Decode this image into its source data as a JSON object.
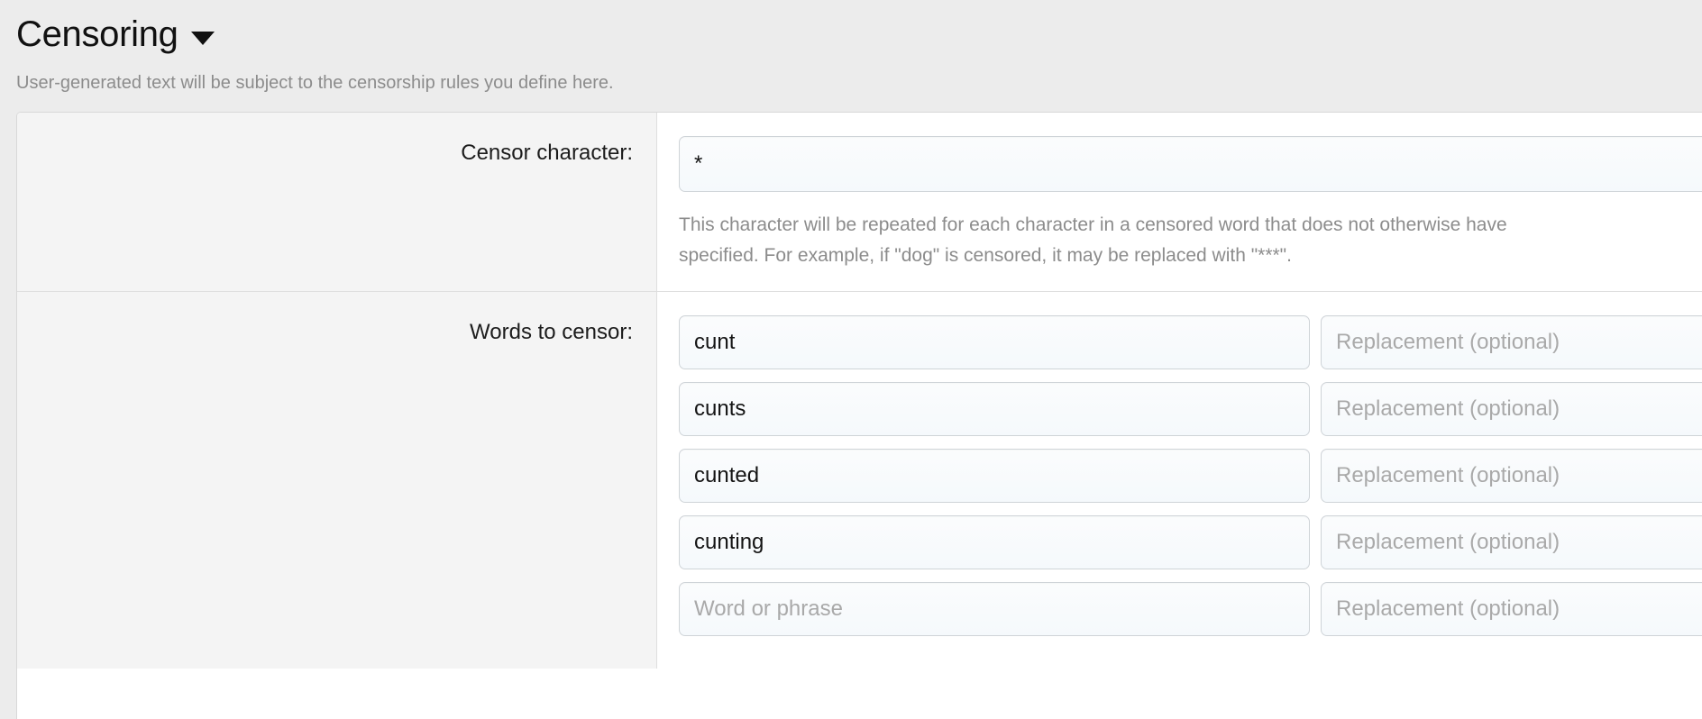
{
  "header": {
    "title": "Censoring",
    "caret_icon": "chevron-down-icon",
    "subtitle": "User-generated text will be subject to the censorship rules you define here."
  },
  "form": {
    "censor_character": {
      "label": "Censor character:",
      "value": "*",
      "help_line_1": "This character will be repeated for each character in a censored word that does not otherwise have",
      "help_line_2": "specified. For example, if \"dog\" is censored, it may be replaced with \"***\"."
    },
    "words_to_censor": {
      "label": "Words to censor:",
      "word_placeholder": "Word or phrase",
      "replacement_placeholder": "Replacement (optional)",
      "rows": [
        {
          "word": "cunt",
          "replacement": ""
        },
        {
          "word": "cunts",
          "replacement": ""
        },
        {
          "word": "cunted",
          "replacement": ""
        },
        {
          "word": "cunting",
          "replacement": ""
        },
        {
          "word": "",
          "replacement": ""
        }
      ]
    }
  },
  "colors": {
    "page_background": "#ececec",
    "panel_background": "#ffffff",
    "label_gutter": "#f4f4f4",
    "divider": "#dedede",
    "title_text": "#111111",
    "muted_text": "#8c8c8c",
    "input_border": "#cfd4d8",
    "input_background": "#f7fafc"
  }
}
